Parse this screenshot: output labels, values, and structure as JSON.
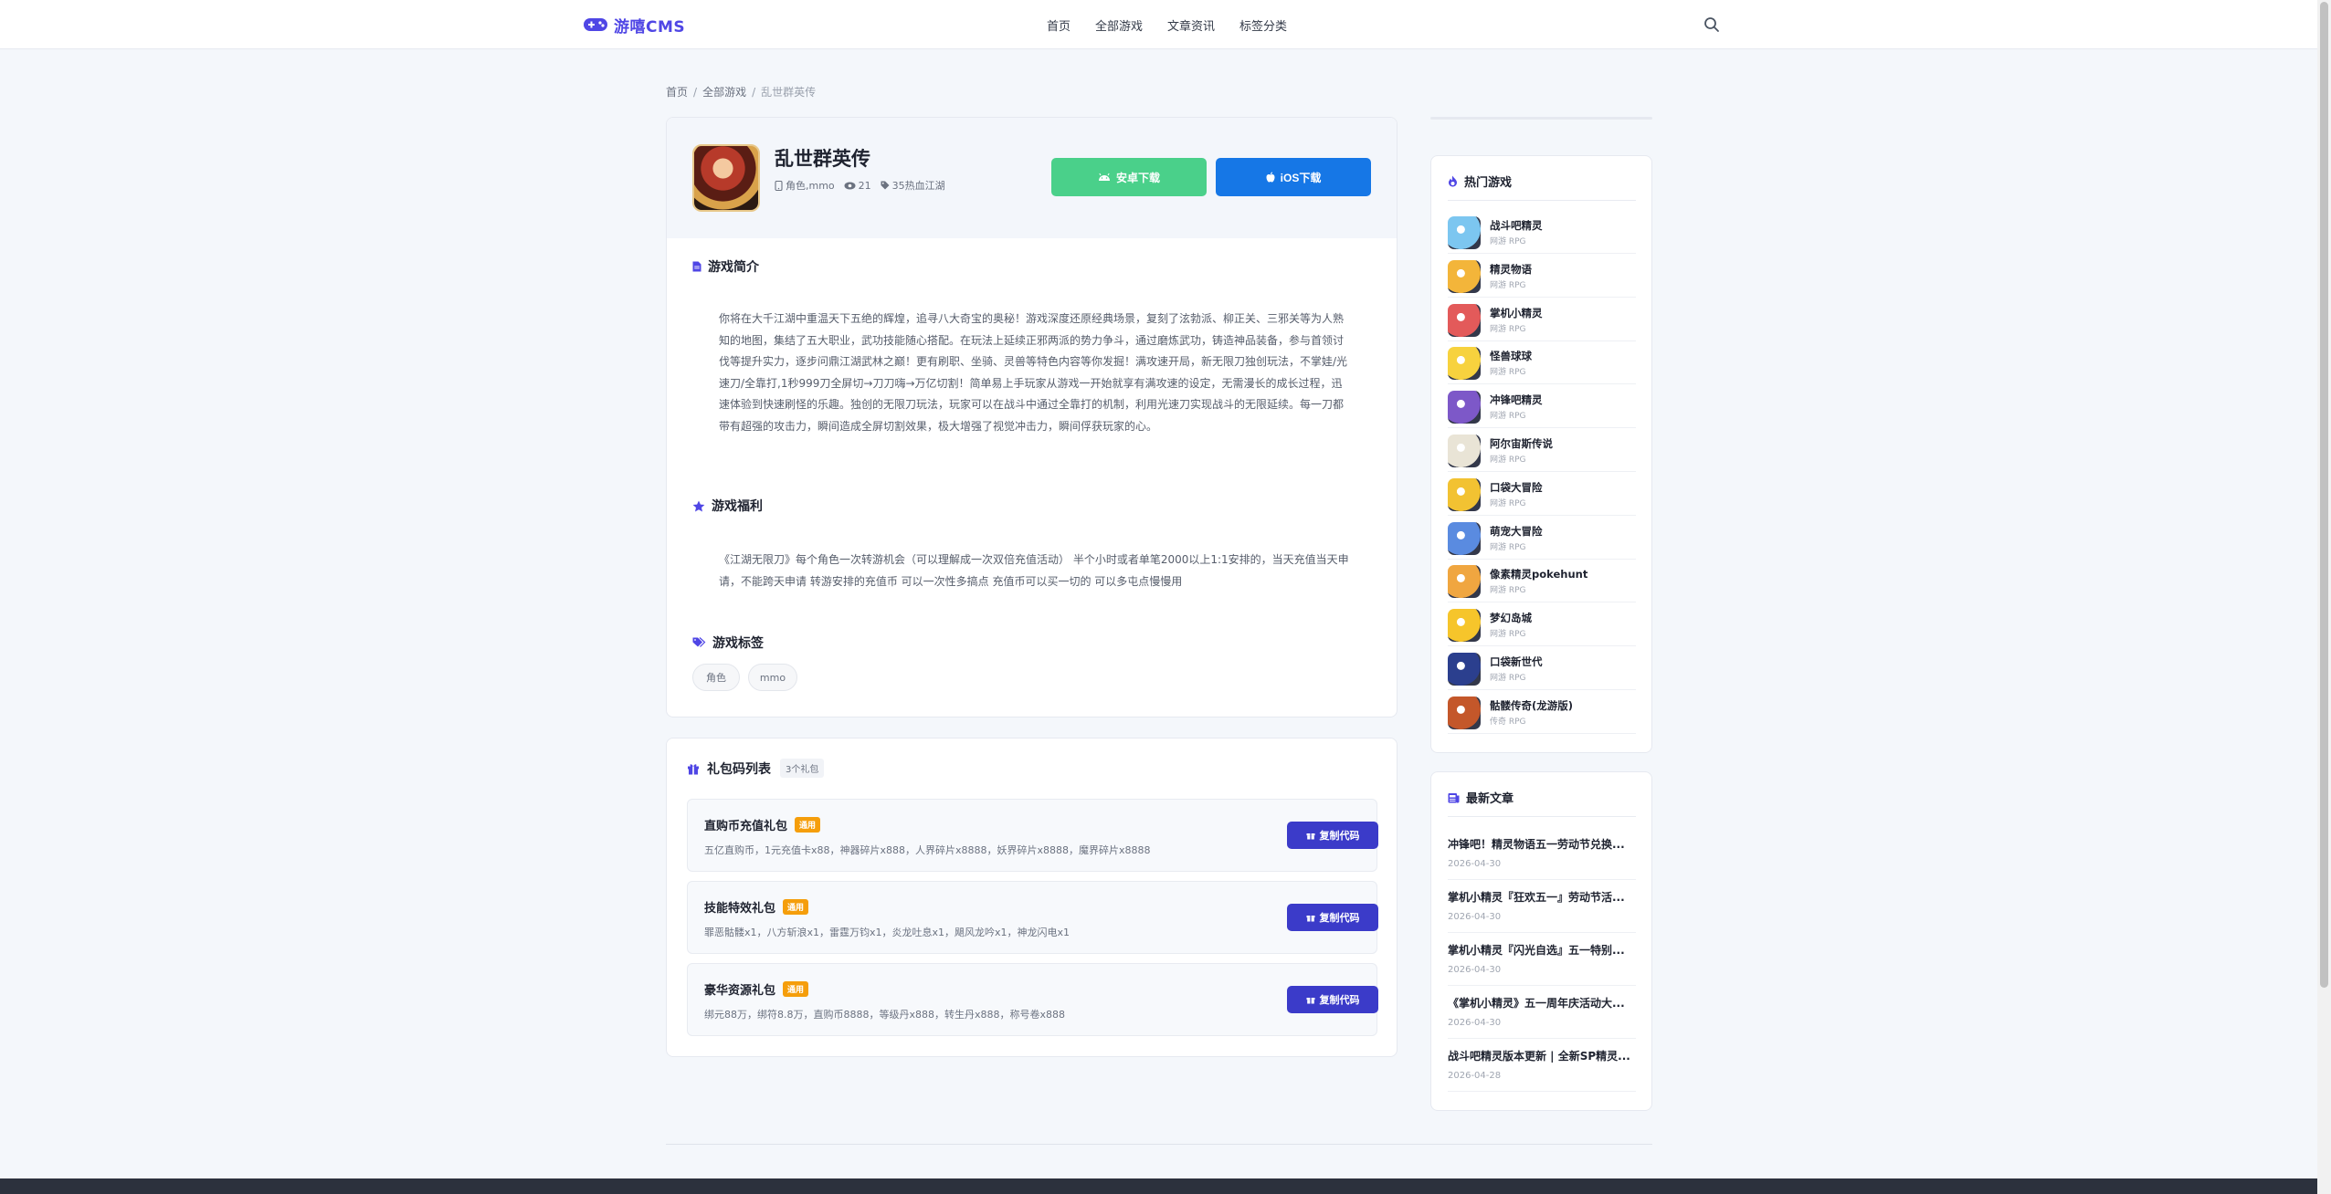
{
  "header": {
    "logo_text": "游嘻CMS",
    "nav": [
      "首页",
      "全部游戏",
      "文章资讯",
      "标签分类"
    ]
  },
  "breadcrumb": [
    "首页",
    "全部游戏",
    "乱世群英传"
  ],
  "game": {
    "title": "乱世群英传",
    "meta_tags": "角色,mmo",
    "meta_views": "21",
    "meta_category": "35热血江湖",
    "android_label": "安卓下载",
    "ios_label": "iOS下载"
  },
  "intro": {
    "title": "游戏简介",
    "text": "你将在大千江湖中重温天下五绝的辉煌，追寻八大奇宝的奥秘！游戏深度还原经典场景，复刻了泫勃派、柳正关、三邪关等为人熟知的地图，集结了五大职业，武功技能随心搭配。在玩法上延续正邪两派的势力争斗，通过磨炼武功，铸造神品装备，参与首领讨伐等提升实力，逐步问鼎江湖武林之巅！更有刷职、坐骑、灵兽等特色内容等你发掘！满攻速开局，新无限刀独创玩法，不掌娃/光速刀/全靠打,1秒999刀全屏切→刀刀嗨→万亿切割！简单易上手玩家从游戏一开始就享有满攻速的设定，无需漫长的成长过程，迅速体验到快速刷怪的乐趣。独创的无限刀玩法，玩家可以在战斗中通过全靠打的机制，利用光速刀实现战斗的无限延续。每一刀都带有超强的攻击力，瞬间造成全屏切割效果，极大增强了视觉冲击力，瞬间俘获玩家的心。"
  },
  "welfare": {
    "title": "游戏福利",
    "text": "《江湖无限刀》每个角色一次转游机会（可以理解成一次双倍充值活动） 半个小时或者单笔2000以上1:1安排的，当天充值当天申请，不能跨天申请 转游安排的充值币 可以一次性多搞点 充值币可以买一切的 可以多屯点慢慢用"
  },
  "tags": {
    "title": "游戏标签",
    "items": [
      "角色",
      "mmo"
    ]
  },
  "gifts": {
    "title": "礼包码列表",
    "count": "3个礼包",
    "copy_label": "复制代码",
    "items": [
      {
        "name": "直购币充值礼包",
        "badge": "通用",
        "desc": "五亿直购币，1元充值卡x88，神器碎片x888，人界碎片x8888，妖界碎片x8888，魔界碎片x8888"
      },
      {
        "name": "技能特效礼包",
        "badge": "通用",
        "desc": "罪恶骷髅x1，八方斩浪x1，雷霆万钧x1，炎龙吐息x1，飓风龙吟x1，神龙闪电x1"
      },
      {
        "name": "豪华资源礼包",
        "badge": "通用",
        "desc": "绑元88万，绑符8.8万，直购币8888，等级丹x888，转生丹x888，称号卷x888"
      }
    ]
  },
  "hot": {
    "title": "热门游戏",
    "items": [
      {
        "name": "战斗吧精灵",
        "cat": "网游 RPG",
        "color": "#7cc6f0"
      },
      {
        "name": "精灵物语",
        "cat": "网游 RPG",
        "color": "#f3b53a"
      },
      {
        "name": "掌机小精灵",
        "cat": "网游 RPG",
        "color": "#e35a5a"
      },
      {
        "name": "怪兽球球",
        "cat": "网游 RPG",
        "color": "#f7d23e"
      },
      {
        "name": "冲锋吧精灵",
        "cat": "网游 RPG",
        "color": "#7d58c8"
      },
      {
        "name": "阿尔宙斯传说",
        "cat": "网游 RPG",
        "color": "#e9e4d6"
      },
      {
        "name": "口袋大冒险",
        "cat": "网游 RPG",
        "color": "#f2c232"
      },
      {
        "name": "萌宠大冒险",
        "cat": "网游 RPG",
        "color": "#5a8be0"
      },
      {
        "name": "像素精灵pokehunt",
        "cat": "网游 RPG",
        "color": "#f0a640"
      },
      {
        "name": "梦幻岛城",
        "cat": "网游 RPG",
        "color": "#f6c52b"
      },
      {
        "name": "口袋新世代",
        "cat": "网游 RPG",
        "color": "#2b3f8e"
      },
      {
        "name": "骷髅传奇(龙游版)",
        "cat": "传奇 RPG",
        "color": "#c4572a"
      }
    ]
  },
  "news": {
    "title": "最新文章",
    "items": [
      {
        "title": "冲锋吧！精灵物语五一劳动节兑换...",
        "date": "2026-04-30"
      },
      {
        "title": "掌机小精灵『狂欢五一』劳动节活...",
        "date": "2026-04-30"
      },
      {
        "title": "掌机小精灵『闪光自选』五一特别...",
        "date": "2026-04-30"
      },
      {
        "title": "《掌机小精灵》五一周年庆活动大...",
        "date": "2026-04-30"
      },
      {
        "title": "战斗吧精灵版本更新 | 全新SP精灵...",
        "date": "2026-04-28"
      }
    ]
  },
  "colors": {
    "accent": "#4f46e5",
    "android": "#4ad08a",
    "ios": "#1677e6",
    "badge": "#f59e0b"
  }
}
